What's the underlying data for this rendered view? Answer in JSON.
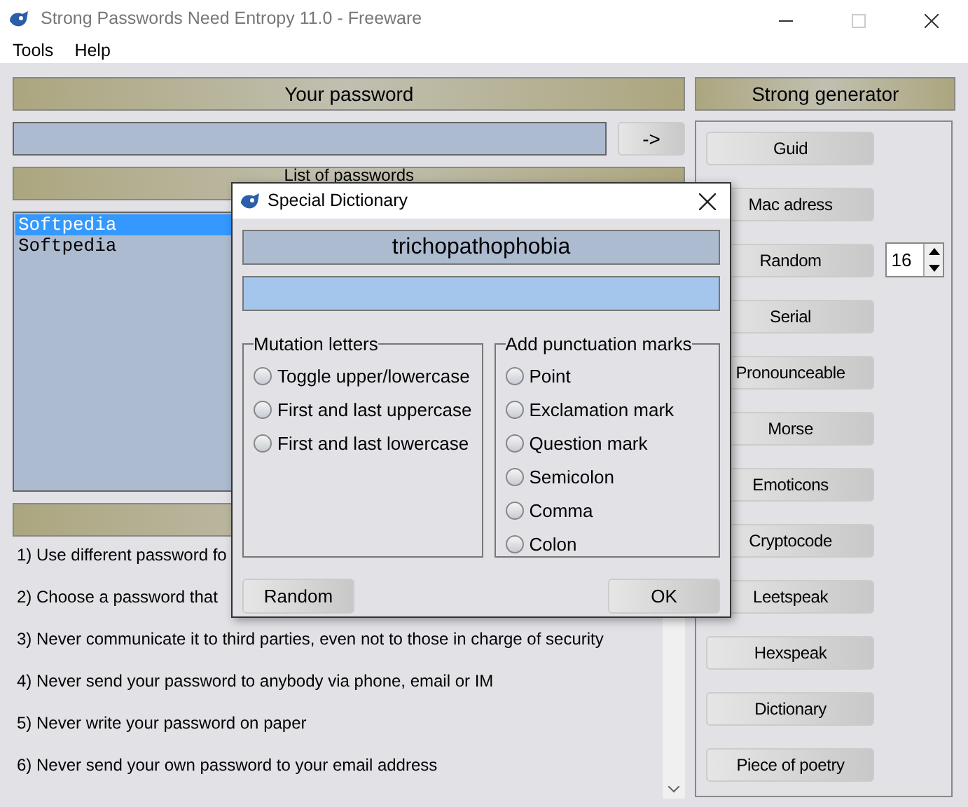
{
  "window": {
    "title": "Strong Passwords Need Entropy 11.0 - Freeware"
  },
  "menu": [
    "Tools",
    "Help"
  ],
  "password_panel": {
    "header": "Your password",
    "arrow_button": "->",
    "list_header": "List of passwords",
    "passwords": [
      {
        "text": "Softpedia",
        "selected": true
      },
      {
        "text": "Softpedia",
        "selected": false
      }
    ],
    "tips": [
      "1) Use different password fo",
      "2) Choose a password that",
      "3) Never communicate it to third parties, even not to those in charge of security",
      "4) Never send your password to anybody via phone, email or IM",
      "5) Never write your password on paper",
      "6) Never send your own password to your email address"
    ]
  },
  "generator": {
    "header": "Strong generator",
    "length": "16",
    "buttons": [
      "Guid",
      "Mac adress",
      "Random",
      "Serial",
      "Pronounceable",
      "Morse",
      "Emoticons",
      "Cryptocode",
      "Leetspeak",
      "Hexspeak",
      "Dictionary",
      "Piece of poetry"
    ]
  },
  "dialog": {
    "title": "Special Dictionary",
    "word": "trichopathophobia",
    "mutation": {
      "title": "Mutation letters",
      "options": [
        {
          "label": "Toggle upper/lowercase",
          "selected": false
        },
        {
          "label": "First and last uppercase",
          "selected": false
        },
        {
          "label": "First and last lowercase",
          "selected": false
        }
      ]
    },
    "punctuation": {
      "title": "Add punctuation marks",
      "options": [
        {
          "label": "Point",
          "selected": false
        },
        {
          "label": "Exclamation mark",
          "selected": false
        },
        {
          "label": "Question mark",
          "selected": false
        },
        {
          "label": "Semicolon",
          "selected": false
        },
        {
          "label": "Comma",
          "selected": false
        },
        {
          "label": "Colon",
          "selected": false
        }
      ]
    },
    "buttons": [
      "Random",
      "OK"
    ]
  }
}
